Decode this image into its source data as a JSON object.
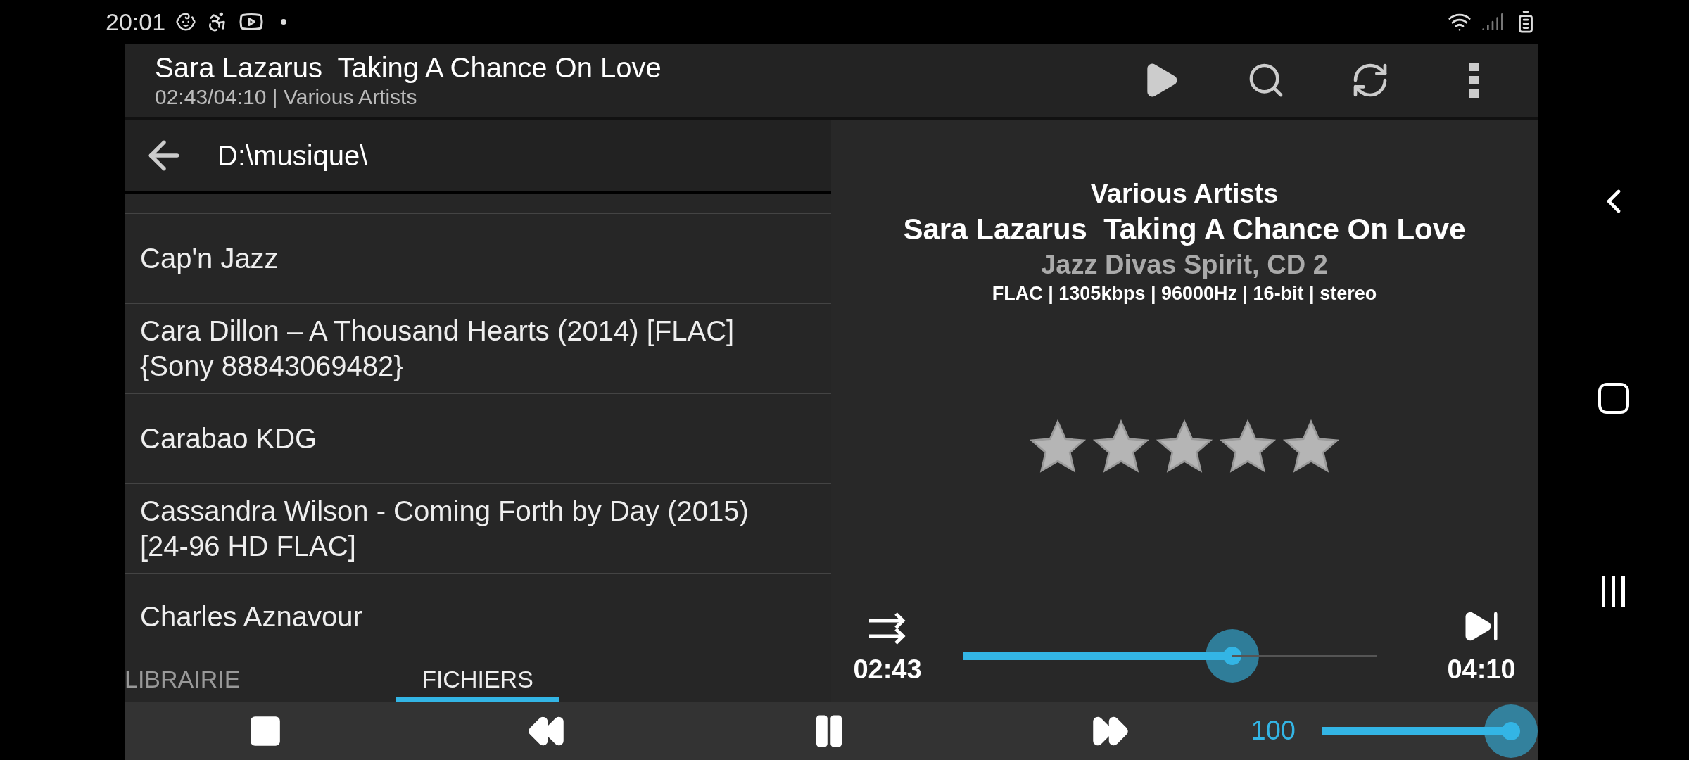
{
  "status_bar": {
    "time": "20:01"
  },
  "now_playing": {
    "title": "Sara Lazarus  Taking A Chance On Love",
    "subtitle": "02:43/04:10 | Various Artists"
  },
  "browser": {
    "path": "D:\\musique\\",
    "items": [
      {
        "label": "Cap'n Jazz"
      },
      {
        "label": "Cara Dillon – A Thousand Hearts (2014) [FLAC] {Sony 88843069482}"
      },
      {
        "label": "Carabao KDG"
      },
      {
        "label": "Cassandra Wilson - Coming Forth by Day (2015) [24-96 HD FLAC]"
      },
      {
        "label": "Charles Aznavour"
      }
    ]
  },
  "track_info": {
    "artist": "Various Artists",
    "title": "Sara Lazarus  Taking A Chance On Love",
    "album": "Jazz Divas Spirit, CD 2",
    "format": "FLAC | 1305kbps | 96000Hz | 16-bit | stereo",
    "stars": 5
  },
  "progress": {
    "elapsed": "02:43",
    "total": "04:10",
    "level": 0.65
  },
  "tabs": [
    {
      "label": "LIBRAIRIE",
      "selected": false
    },
    {
      "label": "FICHIERS",
      "selected": true
    }
  ],
  "volume": {
    "reading": "100",
    "level": 1
  }
}
